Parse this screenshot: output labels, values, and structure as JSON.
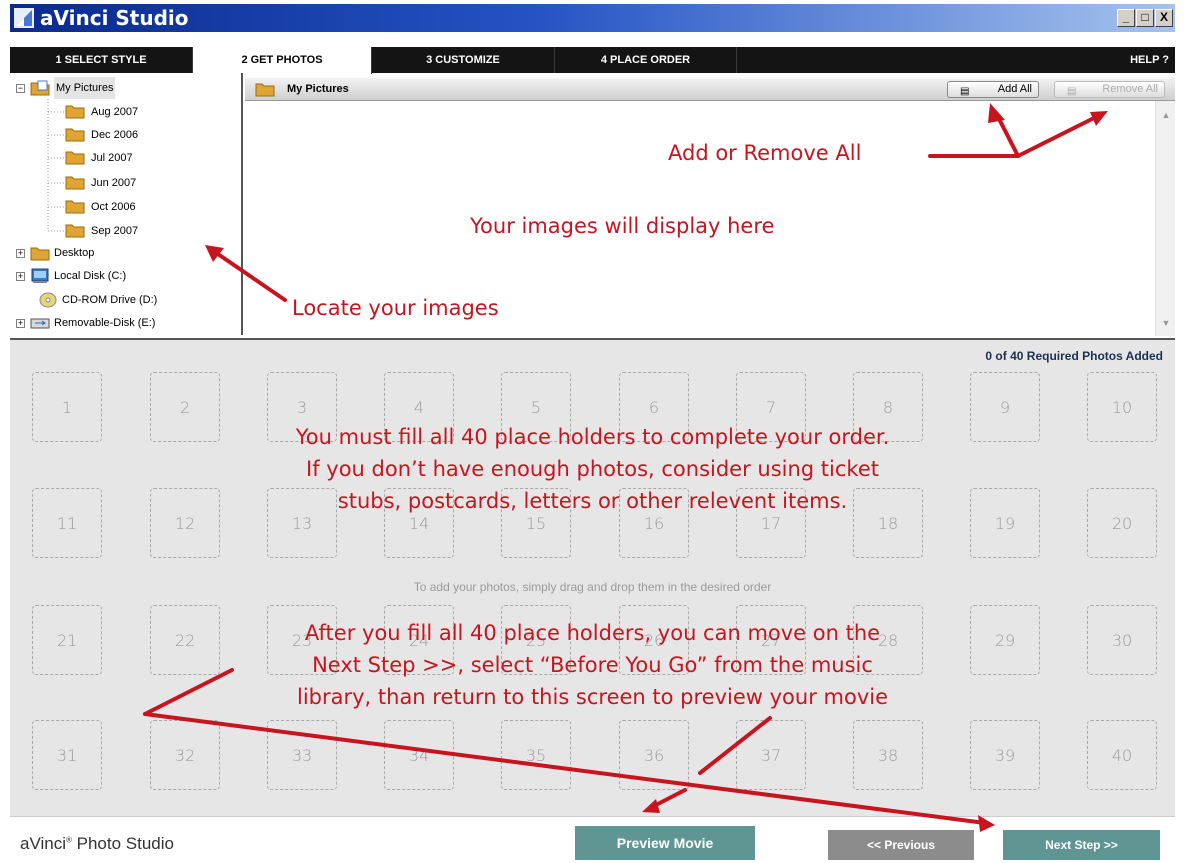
{
  "window": {
    "title": "aVinci Studio",
    "controls": {
      "minimize": "_",
      "maximize": "□",
      "close": "X"
    }
  },
  "tabs": [
    {
      "label": "1 SELECT STYLE",
      "active": false
    },
    {
      "label": "2 GET PHOTOS",
      "active": true
    },
    {
      "label": "3 CUSTOMIZE",
      "active": false
    },
    {
      "label": "4 PLACE ORDER",
      "active": false
    }
  ],
  "help_label": "HELP ?",
  "folder_tree": {
    "root": {
      "label": "My Pictures",
      "expanded": true
    },
    "children": [
      "Aug 2007",
      "Dec 2006",
      "Jul 2007",
      "Jun 2007",
      "Oct 2006",
      "Sep 2007"
    ],
    "drives": [
      {
        "label": "Desktop",
        "icon": "folder-icon",
        "expandable": true
      },
      {
        "label": "Local Disk (C:)",
        "icon": "hard-disk-icon",
        "expandable": true
      },
      {
        "label": "CD-ROM Drive (D:)",
        "icon": "cd-icon",
        "expandable": false
      },
      {
        "label": "Removable-Disk (E:)",
        "icon": "usb-drive-icon",
        "expandable": true
      }
    ]
  },
  "browser": {
    "folder_title": "My Pictures",
    "add_all": "Add All",
    "remove_all": "Remove All"
  },
  "grid": {
    "status": "0 of 40 Required Photos Added",
    "slots": [
      1,
      2,
      3,
      4,
      5,
      6,
      7,
      8,
      9,
      10,
      11,
      12,
      13,
      14,
      15,
      16,
      17,
      18,
      19,
      20,
      21,
      22,
      23,
      24,
      25,
      26,
      27,
      28,
      29,
      30,
      31,
      32,
      33,
      34,
      35,
      36,
      37,
      38,
      39,
      40
    ],
    "hint": "To add your photos, simply drag and drop them in the desired order"
  },
  "footer": {
    "brand": "aVinci",
    "brand_mark": "®",
    "brand_suffix": " Photo Studio",
    "preview": "Preview Movie",
    "previous": "<< Previous",
    "next": "Next Step >>"
  },
  "annotations": {
    "add_remove": "Add or Remove All",
    "display": "Your images will display here",
    "locate": "Locate your images",
    "fill_line1": "You must fill all 40 place holders to complete your order.",
    "fill_line2": "If you don’t have enough photos, consider using ticket",
    "fill_line3": "stubs, postcards, letters or other relevent items.",
    "after_line1": "After you fill all 40 place holders, you can move on the",
    "after_line2": "Next Step >>, select “Before You Go” from the music",
    "after_line3": "library, than return to this screen to preview your movie"
  },
  "colors": {
    "annotation": "#c8141e",
    "teal_button": "#5f9593",
    "gray_button": "#8c8c8c"
  }
}
